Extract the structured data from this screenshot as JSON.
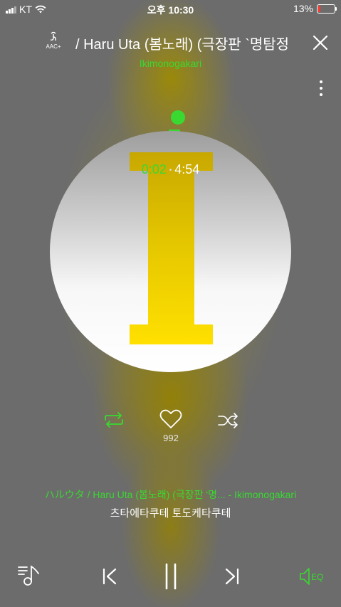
{
  "status": {
    "carrier": "KT",
    "time": "오후 10:30",
    "battery": "13%"
  },
  "header": {
    "codec_label": "AAC+",
    "title": "/ Haru Uta (봄노래) (극장판 `명탐정",
    "artist": "Ikimonogakari"
  },
  "player": {
    "current_time": "0:02",
    "total_time": "4:54",
    "likes": "992",
    "song_line": "ハルウタ / Haru Uta (봄노래) (극장판 '명... - Ikimonogakari",
    "lyric": "츠타에타쿠테 토도케타쿠테"
  },
  "controls": {
    "eq_label": "EQ"
  },
  "colors": {
    "accent": "#39d931",
    "art_yellow": "#f2d400",
    "background": "#6c6c6c"
  },
  "icons": [
    "aac-plus-icon",
    "close-icon",
    "more-icon",
    "repeat-icon",
    "heart-icon",
    "shuffle-icon",
    "playlist-icon",
    "previous-icon",
    "pause-icon",
    "next-icon",
    "eq-speaker-icon"
  ]
}
